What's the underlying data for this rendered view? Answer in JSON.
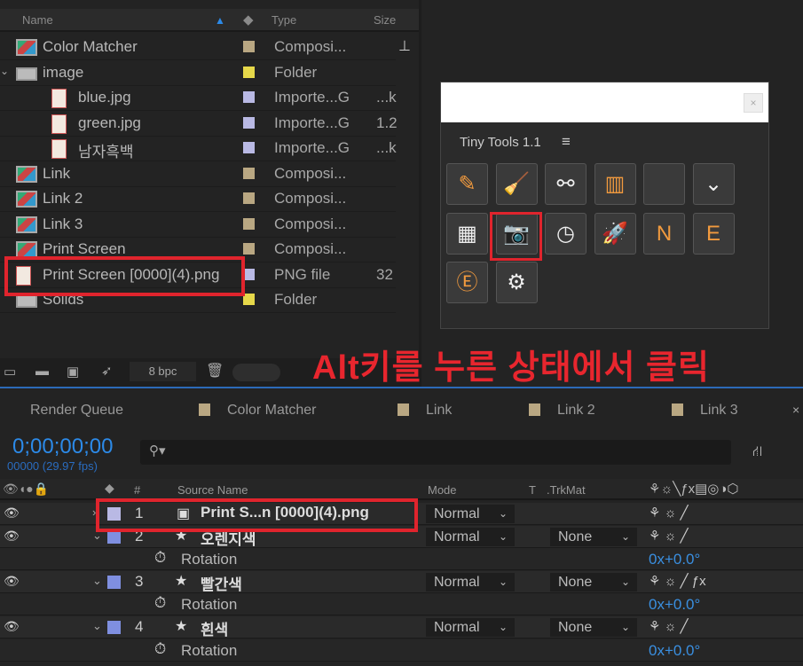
{
  "project": {
    "columns": {
      "name": "Name",
      "type": "Type",
      "size": "Size"
    },
    "items": [
      {
        "name": "Color Matcher",
        "icon": "composition-icon",
        "label_color": "#b9a782",
        "type": "Composi...",
        "size": ""
      },
      {
        "name": "image",
        "icon": "folder-icon",
        "label_color": "#e6d84a",
        "type": "Folder",
        "size": ""
      },
      {
        "name": "blue.jpg",
        "icon": "image-file-icon",
        "label_color": "#b9b9e4",
        "type": "Importe...G",
        "size": "...k"
      },
      {
        "name": "green.jpg",
        "icon": "image-file-icon",
        "label_color": "#b9b9e4",
        "type": "Importe...G",
        "size": "1.2"
      },
      {
        "name": "남자흑백",
        "icon": "image-file-icon",
        "label_color": "#b9b9e4",
        "type": "Importe...G",
        "size": "...k"
      },
      {
        "name": "Link",
        "icon": "composition-icon",
        "label_color": "#b9a782",
        "type": "Composi...",
        "size": ""
      },
      {
        "name": "Link 2",
        "icon": "composition-icon",
        "label_color": "#b9a782",
        "type": "Composi...",
        "size": ""
      },
      {
        "name": "Link 3",
        "icon": "composition-icon",
        "label_color": "#b9a782",
        "type": "Composi...",
        "size": ""
      },
      {
        "name": "Print Screen",
        "icon": "composition-icon",
        "label_color": "#b9a782",
        "type": "Composi...",
        "size": ""
      },
      {
        "name": "Print Screen [0000](4).png",
        "icon": "image-file-icon",
        "label_color": "#b9b9e4",
        "type": "PNG file",
        "size": "32"
      },
      {
        "name": "Solids",
        "icon": "folder-icon",
        "label_color": "#e6d84a",
        "type": "Folder",
        "size": ""
      }
    ],
    "bpc": "8 bpc"
  },
  "tiny_tools": {
    "title": "Tiny Tools 1.1",
    "menu_icon": "≡",
    "tools": [
      "color-picker-icon",
      "broom-icon",
      "nodes-icon",
      "film-icon",
      "code-icon",
      "check-arrow-icon",
      "calculator-icon",
      "camera-icon",
      "history-icon",
      "rocket-icon",
      "loop-n-icon",
      "expression-icon",
      "expression-search-icon",
      "settings-icon"
    ]
  },
  "annotation": "Alt키를 누른 상태에서 클릭",
  "timeline": {
    "tabs": [
      "Render Queue",
      "Color Matcher",
      "Link",
      "Link 2",
      "Link 3"
    ],
    "timecode": "0;00;00;00",
    "frames": "00000 (29.97 fps)",
    "columns": {
      "source_name": "Source Name",
      "mode": "Mode",
      "t": "T",
      "trkmat": ".TrkMat",
      "num": "#"
    },
    "layers": [
      {
        "num": "1",
        "name": "Print S...n [0000](4).png",
        "mode": "Normal",
        "trkmat": "",
        "color": "#b9b9e4"
      },
      {
        "num": "2",
        "name": "오렌지색",
        "mode": "Normal",
        "trkmat": "None",
        "color": "#7f8fe0",
        "prop": "Rotation",
        "value": "0x+0.0°"
      },
      {
        "num": "3",
        "name": "빨간색",
        "mode": "Normal",
        "trkmat": "None",
        "color": "#7f8fe0",
        "prop": "Rotation",
        "value": "0x+0.0°"
      },
      {
        "num": "4",
        "name": "흰색",
        "mode": "Normal",
        "trkmat": "None",
        "color": "#7f8fe0",
        "prop": "Rotation",
        "value": "0x+0.0°"
      }
    ]
  },
  "accent": "#2c8ae8",
  "highlight": "#e0242d"
}
